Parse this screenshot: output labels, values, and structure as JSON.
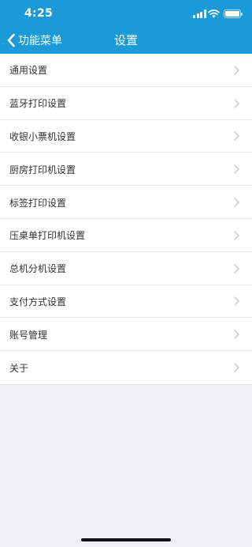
{
  "status_bar": {
    "time": "4:25"
  },
  "nav_bar": {
    "back_label": "功能菜单",
    "title": "设置"
  },
  "menu": [
    {
      "key": "general",
      "label": "通用设置"
    },
    {
      "key": "bluetooth-print",
      "label": "蓝牙打印设置"
    },
    {
      "key": "receipt-printer",
      "label": "收银小票机设置"
    },
    {
      "key": "kitchen-printer",
      "label": "厨房打印机设置"
    },
    {
      "key": "label-print",
      "label": "标签打印设置"
    },
    {
      "key": "table-printer",
      "label": "压桌单打印机设置"
    },
    {
      "key": "host-branch",
      "label": "总机分机设置"
    },
    {
      "key": "payment-methods",
      "label": "支付方式设置"
    },
    {
      "key": "account",
      "label": "账号管理"
    },
    {
      "key": "about",
      "label": "关于"
    }
  ],
  "colors": {
    "header": "#1a9ad6",
    "background": "#efeff4",
    "row": "#ffffff",
    "row_text": "#333333",
    "chevron": "#c7c7cc"
  },
  "icons": {
    "back": "chevron-left-icon",
    "row_accessory": "chevron-right-icon",
    "status": [
      "signal-icon",
      "wifi-icon",
      "battery-icon"
    ]
  }
}
